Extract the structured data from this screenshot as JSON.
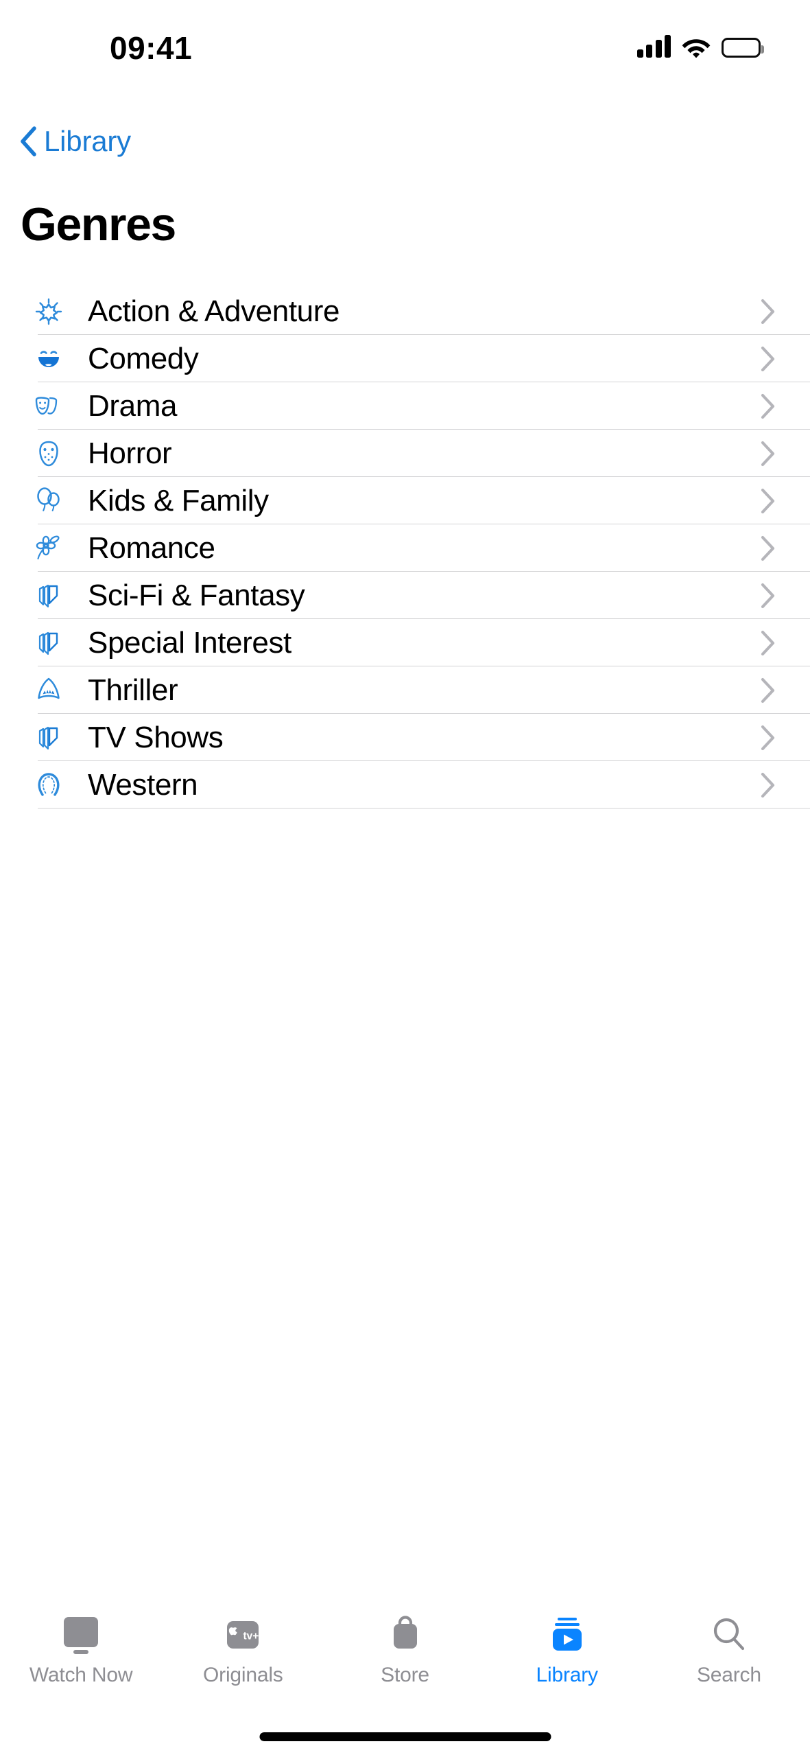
{
  "status_bar": {
    "time": "09:41",
    "cellular_icon": "signal-bars-icon",
    "wifi_icon": "wifi-icon",
    "battery_icon": "battery-full-icon"
  },
  "nav": {
    "back_label": "Library",
    "back_icon": "chevron-left-icon",
    "title": "Genres"
  },
  "colors": {
    "accent_blue": "#0a84ff",
    "link_blue": "#1a7bd4",
    "icon_blue": "#2e8bdb",
    "separator": "#d2d2d4",
    "chevron_gray": "#b5b5ba",
    "tab_inactive": "#8e8e93"
  },
  "genres": [
    {
      "label": "Action & Adventure",
      "icon": "explosion-icon",
      "chevron": "chevron-right-icon"
    },
    {
      "label": "Comedy",
      "icon": "laughing-face-icon",
      "chevron": "chevron-right-icon"
    },
    {
      "label": "Drama",
      "icon": "theater-masks-icon",
      "chevron": "chevron-right-icon"
    },
    {
      "label": "Horror",
      "icon": "hockey-mask-icon",
      "chevron": "chevron-right-icon"
    },
    {
      "label": "Kids & Family",
      "icon": "balloons-icon",
      "chevron": "chevron-right-icon"
    },
    {
      "label": "Romance",
      "icon": "flower-icon",
      "chevron": "chevron-right-icon"
    },
    {
      "label": "Sci-Fi & Fantasy",
      "icon": "stacked-layers-icon",
      "chevron": "chevron-right-icon"
    },
    {
      "label": "Special Interest",
      "icon": "stacked-layers-icon",
      "chevron": "chevron-right-icon"
    },
    {
      "label": "Thriller",
      "icon": "shark-icon",
      "chevron": "chevron-right-icon"
    },
    {
      "label": "TV Shows",
      "icon": "stacked-layers-icon",
      "chevron": "chevron-right-icon"
    },
    {
      "label": "Western",
      "icon": "horseshoe-icon",
      "chevron": "chevron-right-icon"
    }
  ],
  "tab_bar": {
    "items": [
      {
        "label": "Watch Now",
        "icon": "tv-monitor-icon",
        "active": false
      },
      {
        "label": "Originals",
        "icon": "apple-tv-plus-icon",
        "active": false
      },
      {
        "label": "Store",
        "icon": "shopping-bag-icon",
        "active": false
      },
      {
        "label": "Library",
        "icon": "library-play-icon",
        "active": true
      },
      {
        "label": "Search",
        "icon": "magnifier-icon",
        "active": false
      }
    ]
  }
}
